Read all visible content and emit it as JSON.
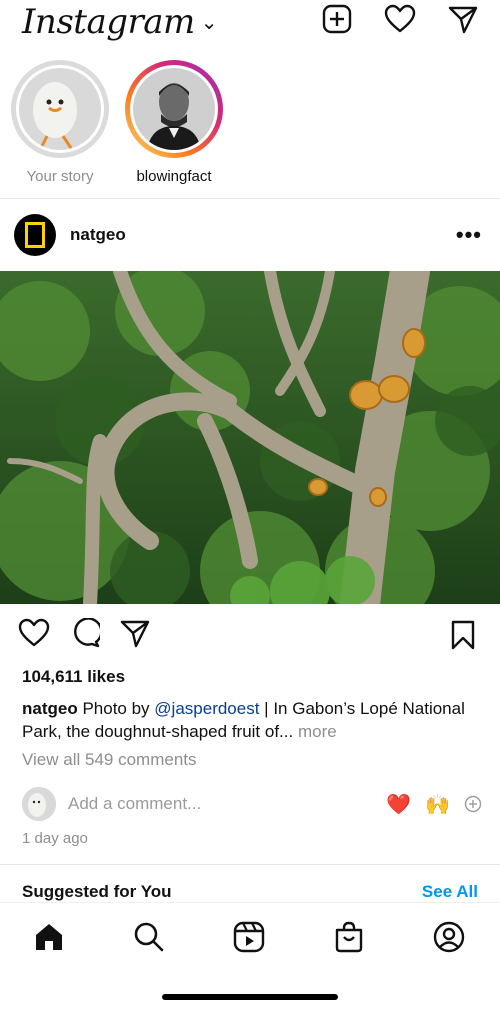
{
  "header": {
    "app_name": "Instagram",
    "dropdown_glyph": "⌄"
  },
  "stories": [
    {
      "label": "Your story"
    },
    {
      "label": "blowingfact"
    }
  ],
  "post": {
    "username": "natgeo",
    "more_glyph": "•••",
    "likes": "104,611 likes",
    "caption_user": "natgeo",
    "caption_part1": " Photo by ",
    "caption_mention": "@jasperdoest",
    "caption_part2": " | In Gabon’s Lopé National Park, the doughnut-shaped fruit of...",
    "caption_more": " more",
    "view_comments": "View all 549 comments",
    "comment_placeholder": "Add a comment...",
    "quick_emojis": [
      "❤️",
      "🙌"
    ],
    "timestamp": "1 day ago"
  },
  "suggested": {
    "title": "Suggested for You",
    "see_all": "See All"
  },
  "colors": {
    "link": "#0095f6",
    "story_ring_start": "#feda75",
    "story_ring_end": "#d62976"
  }
}
